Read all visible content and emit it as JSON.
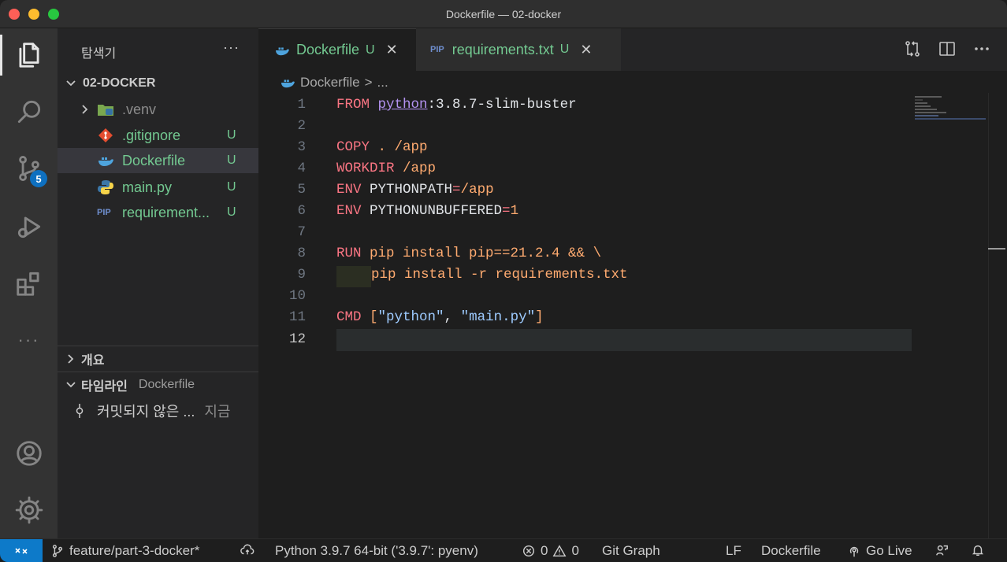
{
  "window": {
    "title": "Dockerfile — 02-docker"
  },
  "activity": {
    "scm_badge": "5",
    "more": "···"
  },
  "sidebar": {
    "header": "탐색기",
    "more": "···",
    "project": "02-DOCKER",
    "items": [
      {
        "name": ".venv",
        "status": ""
      },
      {
        "name": ".gitignore",
        "status": "U"
      },
      {
        "name": "Dockerfile",
        "status": "U"
      },
      {
        "name": "main.py",
        "status": "U"
      },
      {
        "name": "requirement...",
        "status": "U"
      }
    ],
    "outline": "개요",
    "timeline": {
      "title": "타임라인",
      "file": "Dockerfile",
      "entry": "커밋되지 않은 ...",
      "time": "지금"
    }
  },
  "tabs": [
    {
      "label": "Dockerfile",
      "status": "U",
      "close": "✕"
    },
    {
      "label": "requirements.txt",
      "status": "U",
      "close": "✕"
    }
  ],
  "breadcrumb": {
    "file": "Dockerfile",
    "sep": ">",
    "rest": "..."
  },
  "editor": {
    "line_numbers": [
      "1",
      "2",
      "3",
      "4",
      "5",
      "6",
      "7",
      "8",
      "9",
      "10",
      "11",
      "12"
    ],
    "current_line": "12",
    "lines": {
      "l1": {
        "kw": "FROM",
        "image": "python",
        "tag": ":3.8.7-slim-buster"
      },
      "l3": {
        "kw": "COPY",
        "args": " . /app"
      },
      "l4": {
        "kw": "WORKDIR",
        "args": " /app"
      },
      "l5": {
        "kw": "ENV",
        "key": " PYTHONPATH",
        "eq": "=",
        "val": "/app"
      },
      "l6": {
        "kw": "ENV",
        "key": " PYTHONUNBUFFERED",
        "eq": "=",
        "val": "1"
      },
      "l8": {
        "kw": "RUN",
        "args": " pip install pip==21.2.4 && \\"
      },
      "l9": {
        "args": "pip install -r requirements.txt"
      },
      "l11": {
        "kw": "CMD",
        "open": " [",
        "s1": "\"python\"",
        "comma": ", ",
        "s2": "\"main.py\"",
        "close": "]"
      }
    }
  },
  "status": {
    "branch": "feature/part-3-docker*",
    "python": "Python 3.9.7 64-bit ('3.9.7': pyenv)",
    "errors": "0",
    "warnings": "0",
    "git_graph": "Git Graph",
    "eol": "LF",
    "language": "Dockerfile",
    "go_live": "Go Live"
  },
  "colors": {
    "accent": "#0d7ac9",
    "untracked": "#73c991",
    "keyword": "#f97583",
    "string": "#9ecbff"
  }
}
